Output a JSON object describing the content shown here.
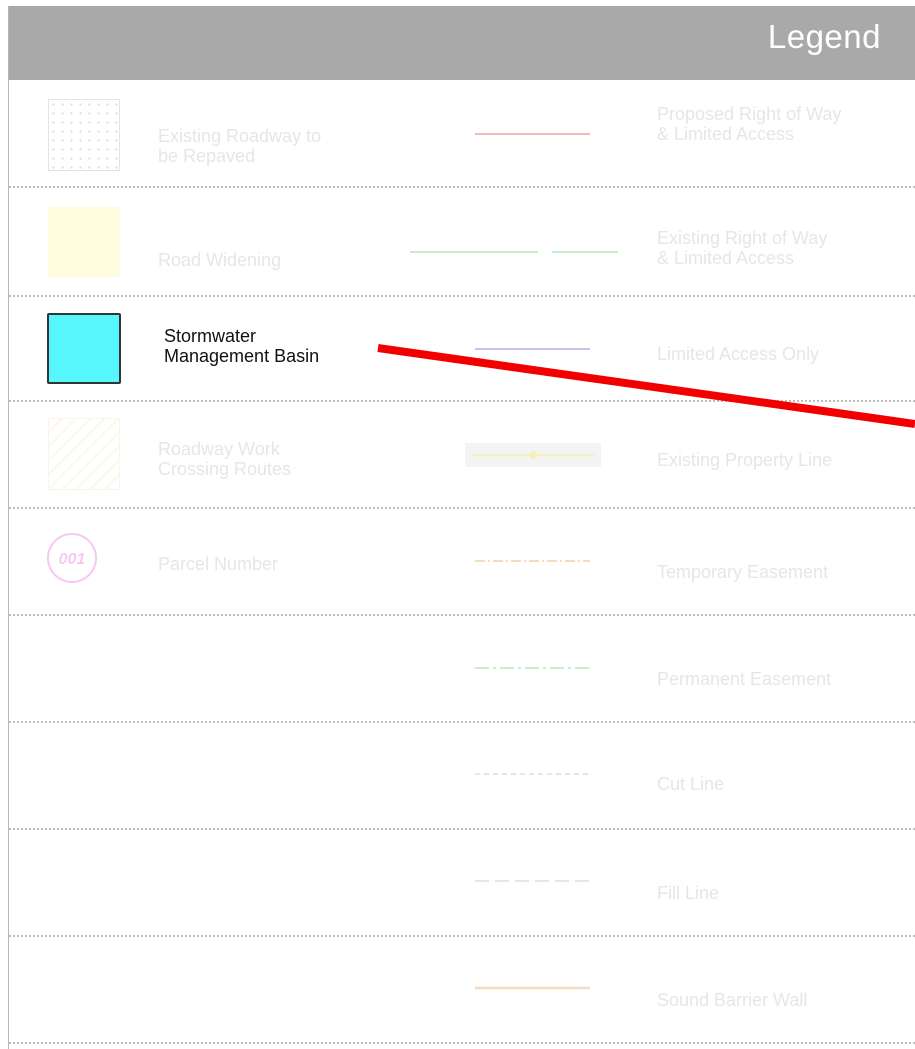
{
  "header": {
    "title": "Legend"
  },
  "left_column": [
    {
      "label": "Existing Roadway to\nbe Repaved",
      "icon": "stipple-swatch-icon",
      "active": false
    },
    {
      "label": "Road Widening",
      "icon": "yellow-swatch-icon",
      "color": "#fffde0",
      "active": false
    },
    {
      "label": "Stormwater\nManagement Basin",
      "icon": "cyan-swatch-icon",
      "color": "#55f7fc",
      "active": true
    },
    {
      "label": "Roadway Work\nCrossing Routes",
      "icon": "hatched-swatch-icon",
      "active": false
    },
    {
      "label": "Parcel Number",
      "icon": "parcel-number-icon",
      "badge": "001",
      "active": false
    }
  ],
  "right_column": [
    {
      "label": "Proposed Right of Way\n& Limited Access",
      "icon": "red-line-icon",
      "color": "#f6b9b9"
    },
    {
      "label": "Existing Right of Way\n& Limited Access",
      "icon": "green-line-icon",
      "color": "#c7efc7"
    },
    {
      "label": "Limited Access Only",
      "icon": "blue-line-icon",
      "color": "#c4c4f2"
    },
    {
      "label": "Existing Property Line",
      "icon": "property-line-icon",
      "color": "#f3f0c2"
    },
    {
      "label": "Temporary Easement",
      "icon": "orange-dashed-line-icon",
      "color": "#f7dcb9"
    },
    {
      "label": "Permanent Easement",
      "icon": "green-dashed-line-icon",
      "color": "#c8f0c8"
    },
    {
      "label": "Cut Line",
      "icon": "cut-line-icon",
      "color": "#e4e4ec"
    },
    {
      "label": "Fill Line",
      "icon": "fill-line-icon",
      "color": "#e6e6e6"
    },
    {
      "label": "Sound Barrier Wall",
      "icon": "orange-line-icon",
      "color": "#f7d9bf"
    }
  ],
  "highlight": {
    "pointer": "red-pointer-arrow",
    "color": "#f20000"
  }
}
